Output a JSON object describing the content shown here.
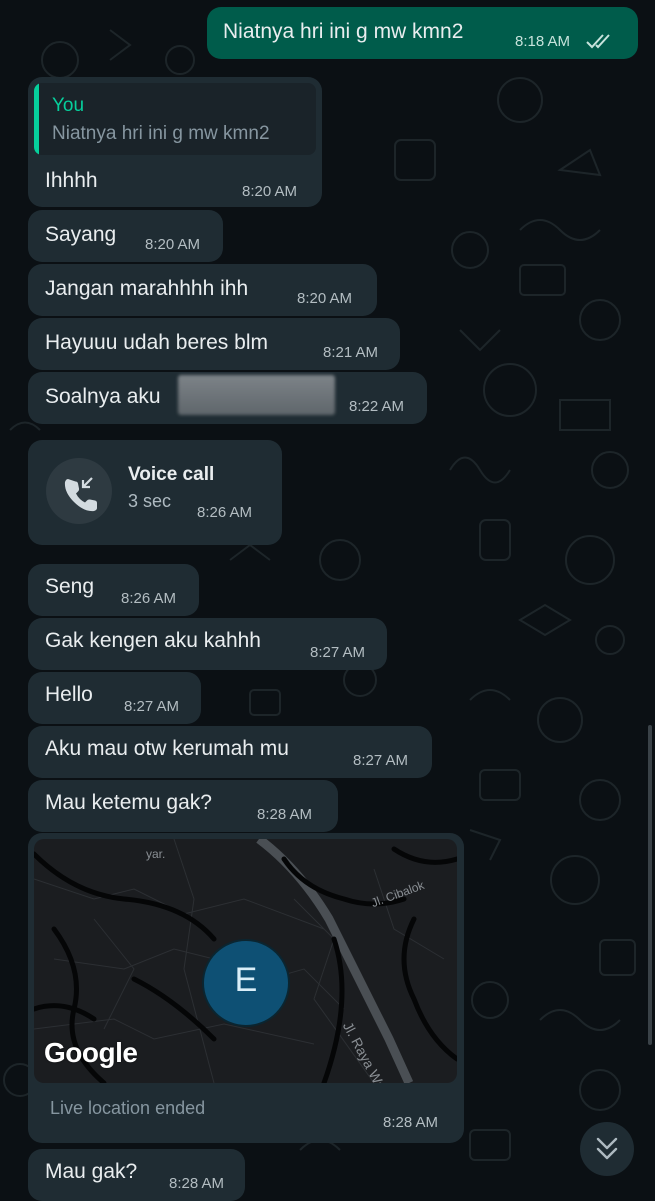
{
  "messages": {
    "m0": {
      "text": "Niatnya hri ini g mw kmn2",
      "time": "8:18 AM",
      "status": "double-check-icon"
    },
    "m1": {
      "quote_author": "You",
      "quote_text": "Niatnya hri ini g mw kmn2",
      "text": "Ihhhh",
      "time": "8:20 AM"
    },
    "m2": {
      "text": "Sayang",
      "time": "8:20 AM"
    },
    "m3": {
      "text": "Jangan marahhhh ihh",
      "time": "8:20 AM"
    },
    "m4": {
      "text": "Hayuuu udah beres blm",
      "time": "8:21 AM"
    },
    "m5": {
      "text": "Soalnya aku",
      "time": "8:22 AM"
    },
    "m6": {
      "call_title": "Voice call",
      "call_duration": "3 sec",
      "time": "8:26 AM"
    },
    "m7": {
      "text": "Seng",
      "time": "8:26 AM"
    },
    "m8": {
      "text": "Gak kengen aku kahhh",
      "time": "8:27 AM"
    },
    "m9": {
      "text": "Hello",
      "time": "8:27 AM"
    },
    "m10": {
      "text": "Aku mau otw kerumah mu",
      "time": "8:27 AM"
    },
    "m11": {
      "text": "Mau ketemu gak?",
      "time": "8:28 AM"
    },
    "m12": {
      "map_labels": [
        "yar.",
        "Jl. Cibalok",
        "Jl. Raya Wangun"
      ],
      "avatar_letter": "E",
      "map_logo": "Google",
      "live_status": "Live location ended",
      "time": "8:28 AM"
    },
    "m13": {
      "text": "Mau gak?",
      "time": "8:28 AM"
    }
  },
  "icons": {
    "call": "incoming-call-icon",
    "scroll": "double-chevron-down-icon"
  },
  "colors": {
    "background": "#0b1014",
    "incoming_bubble": "#1f2c33",
    "outgoing_bubble": "#005c4b",
    "accent": "#06cf9c",
    "avatar": "#0e5074"
  }
}
